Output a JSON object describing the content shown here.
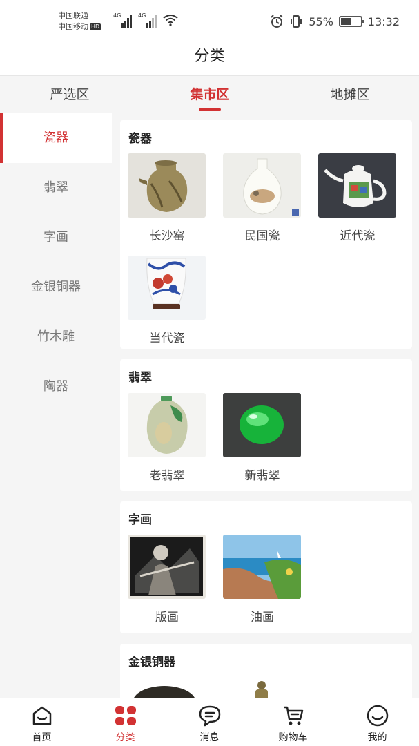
{
  "status_bar": {
    "carrier1": "中国联通",
    "carrier2": "中国移动",
    "hd": "HD",
    "net1": "4G",
    "net2": "4G",
    "battery_percent": "55%",
    "battery_level": 0.55,
    "time": "13:32"
  },
  "header": {
    "title": "分类"
  },
  "top_tabs": [
    {
      "label": "严选区",
      "active": false
    },
    {
      "label": "集市区",
      "active": true
    },
    {
      "label": "地摊区",
      "active": false
    }
  ],
  "sidebar": {
    "items": [
      {
        "label": "瓷器",
        "active": true
      },
      {
        "label": "翡翠",
        "active": false
      },
      {
        "label": "字画",
        "active": false
      },
      {
        "label": "金银铜器",
        "active": false
      },
      {
        "label": "竹木雕",
        "active": false
      },
      {
        "label": "陶器",
        "active": false
      }
    ]
  },
  "sections": [
    {
      "title": "瓷器",
      "items": [
        {
          "label": "长沙窑"
        },
        {
          "label": "民国瓷"
        },
        {
          "label": "近代瓷"
        },
        {
          "label": "当代瓷"
        }
      ]
    },
    {
      "title": "翡翠",
      "items": [
        {
          "label": "老翡翠"
        },
        {
          "label": "新翡翠"
        }
      ]
    },
    {
      "title": "字画",
      "items": [
        {
          "label": "版画"
        },
        {
          "label": "油画"
        }
      ]
    },
    {
      "title": "金银铜器",
      "items": []
    }
  ],
  "bottom_nav": [
    {
      "label": "首页",
      "icon": "home-icon",
      "active": false
    },
    {
      "label": "分类",
      "icon": "category-icon",
      "active": true
    },
    {
      "label": "消息",
      "icon": "message-icon",
      "active": false
    },
    {
      "label": "购物车",
      "icon": "cart-icon",
      "active": false
    },
    {
      "label": "我的",
      "icon": "profile-icon",
      "active": false
    }
  ],
  "colors": {
    "accent": "#d23233",
    "background": "#f5f5f5",
    "card": "#ffffff"
  }
}
